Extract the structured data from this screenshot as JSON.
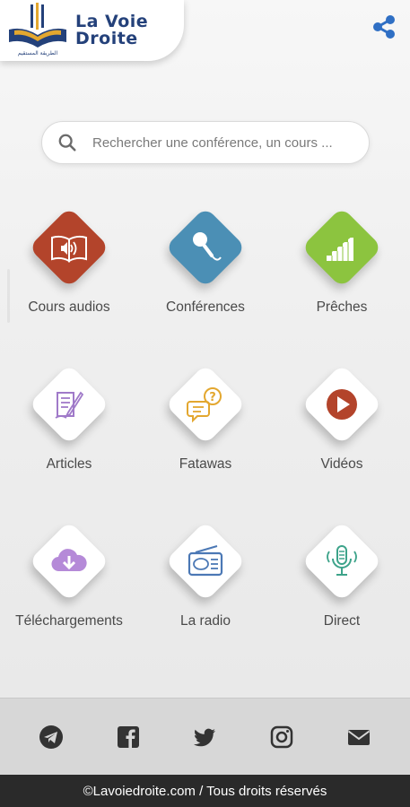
{
  "header": {
    "logo_line1": "La Voie",
    "logo_line2": "Droite",
    "logo_arabic": "الطريقة المستقيم"
  },
  "search": {
    "placeholder": "Rechercher une conférence, un cours ..."
  },
  "menu": [
    {
      "label": "Cours audios",
      "icon": "book-audio-icon",
      "color": "#b3442b"
    },
    {
      "label": "Conférences",
      "icon": "microphone-icon",
      "color": "#4b8fb5"
    },
    {
      "label": "Prêches",
      "icon": "minbar-stairs-icon",
      "color": "#8cc43f"
    },
    {
      "label": "Articles",
      "icon": "document-pen-icon",
      "color": "#ffffff"
    },
    {
      "label": "Fatawas",
      "icon": "question-chat-icon",
      "color": "#ffffff"
    },
    {
      "label": "Vidéos",
      "icon": "play-circle-icon",
      "color": "#ffffff"
    },
    {
      "label": "Téléchargements",
      "icon": "cloud-download-icon",
      "color": "#ffffff"
    },
    {
      "label": "La radio",
      "icon": "radio-icon",
      "color": "#ffffff"
    },
    {
      "label": "Direct",
      "icon": "live-microphone-icon",
      "color": "#ffffff"
    }
  ],
  "social": [
    "telegram-icon",
    "facebook-icon",
    "twitter-icon",
    "instagram-icon",
    "mail-icon"
  ],
  "footer": {
    "copyright": "©Lavoiedroite.com / Tous droits réservés"
  },
  "colors": {
    "brand_navy": "#24417a",
    "brand_gold": "#e3a72f",
    "share_blue": "#2f6fc4"
  }
}
